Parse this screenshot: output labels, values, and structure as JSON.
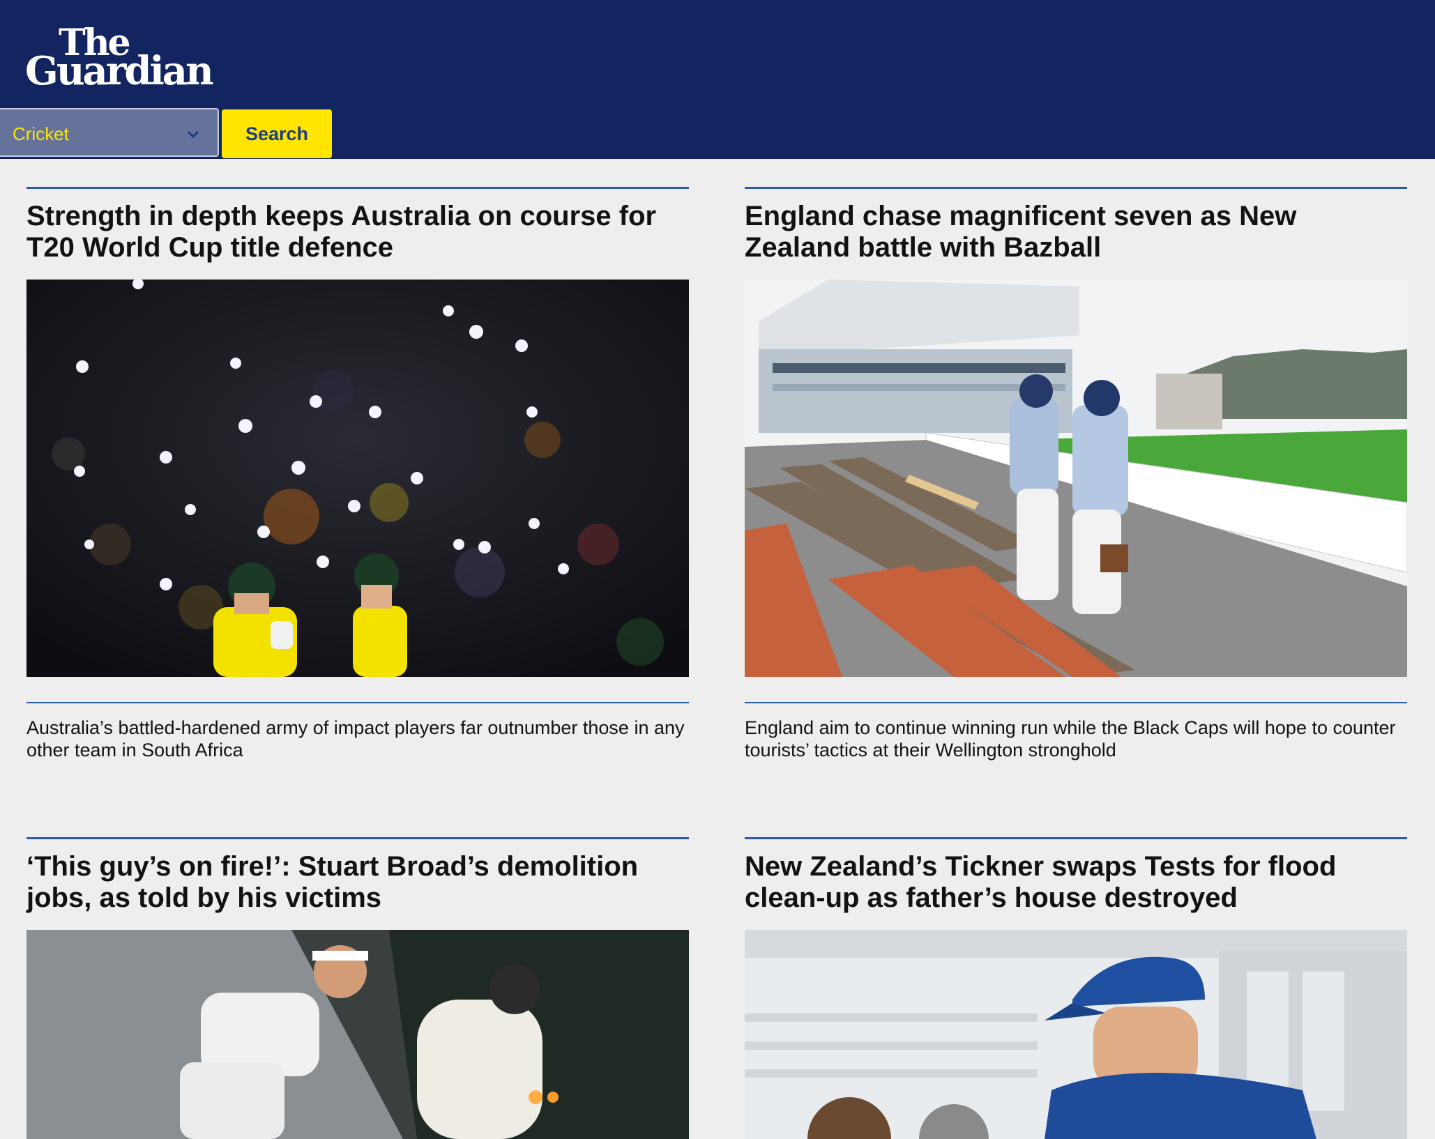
{
  "header": {
    "logo_line1": "The",
    "logo_line2": "Guardian",
    "background_color": "#132561",
    "accent_color": "#ffe500"
  },
  "search": {
    "select_value": "Cricket",
    "button_label": "Search",
    "arrow_icon": "chevron-down-icon"
  },
  "articles": [
    {
      "headline": "Strength in depth keeps Australia on course for T20 World Cup title defence",
      "standfirst": "Australia’s battled-hardened army of impact players far outnumber those in any other team in South Africa",
      "image": "cricket-night-crowd-photo"
    },
    {
      "headline": "England chase magnificent seven as New Zealand battle with Bazball",
      "standfirst": "England aim to continue winning run while the Black Caps will hope to counter tourists’ tactics at their Wellington stronghold",
      "image": "stadium-stands-photo"
    },
    {
      "headline": "‘This guy’s on fire!’: Stuart Broad’s demolition jobs, as told by his victims",
      "image": "bowler-action-photo"
    },
    {
      "headline": "New Zealand’s Tickner swaps Tests for flood clean-up as father’s house destroyed",
      "image": "player-cap-photo"
    }
  ]
}
